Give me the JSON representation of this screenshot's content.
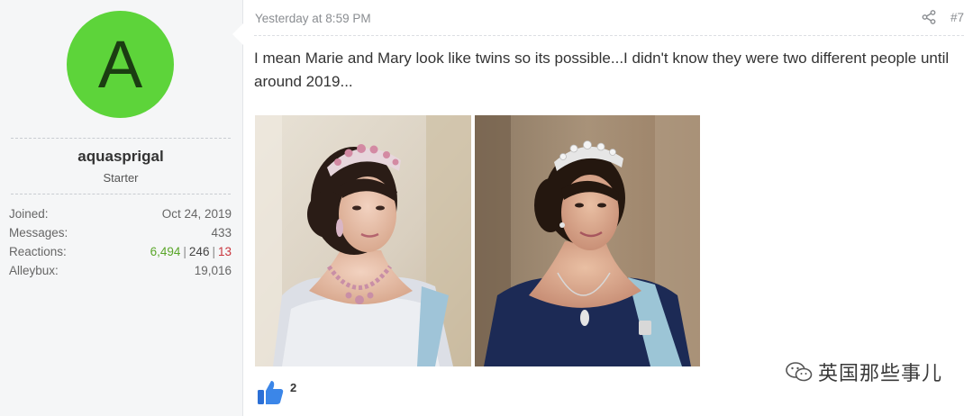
{
  "user": {
    "avatar_letter": "A",
    "avatar_color": "#5dd43a",
    "name": "aquasprigal",
    "title": "Starter",
    "stats": {
      "joined_label": "Joined:",
      "joined_value": "Oct 24, 2019",
      "messages_label": "Messages:",
      "messages_value": "433",
      "reactions_label": "Reactions:",
      "reactions_positive": "6,494",
      "reactions_neutral": "246",
      "reactions_negative": "13",
      "alleybux_label": "Alleybux:",
      "alleybux_value": "19,016"
    }
  },
  "post": {
    "timestamp": "Yesterday at 8:59 PM",
    "number": "#7",
    "text": "I mean Marie and Mary look like twins so its possible...I didn't know they were two different people until around 2019...",
    "images": [
      {
        "icon": "photo-mary-tiara"
      },
      {
        "icon": "photo-marie-tiara"
      }
    ],
    "reactions": {
      "icon": "thumbs-up-icon",
      "count": "2"
    }
  },
  "watermark": {
    "icon": "wechat-icon",
    "text": "英国那些事儿"
  }
}
